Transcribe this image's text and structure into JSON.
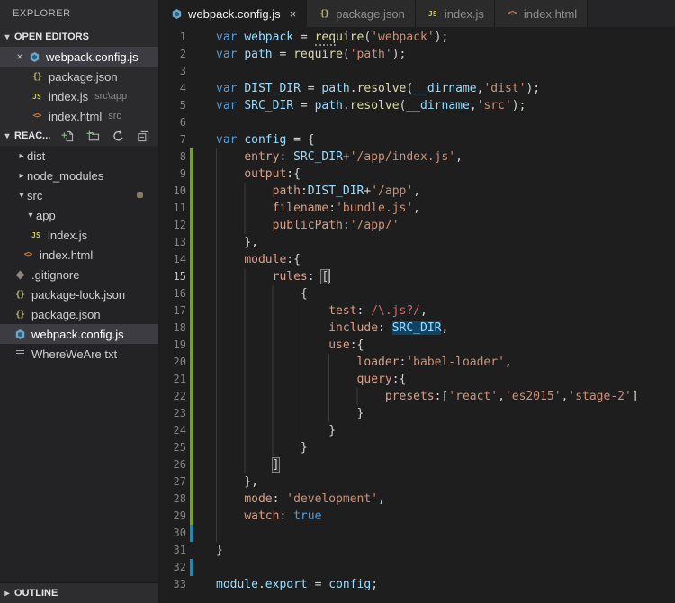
{
  "sidebar": {
    "title": "EXPLORER",
    "open_editors": {
      "header": "OPEN EDITORS",
      "items": [
        {
          "name": "webpack.config.js",
          "icon": "webpack",
          "active": true
        },
        {
          "name": "package.json",
          "icon": "json"
        },
        {
          "name": "index.js",
          "icon": "js",
          "path": "src\\app"
        },
        {
          "name": "index.html",
          "icon": "html",
          "path": "src"
        }
      ]
    },
    "project": {
      "header": "REAC...",
      "actions": [
        "new-file",
        "new-folder",
        "refresh",
        "collapse-all"
      ]
    },
    "tree": [
      {
        "name": "dist",
        "type": "folder",
        "collapsed": true,
        "level": 0
      },
      {
        "name": "node_modules",
        "type": "folder",
        "collapsed": true,
        "level": 0
      },
      {
        "name": "src",
        "type": "folder",
        "collapsed": false,
        "level": 0,
        "badge": true
      },
      {
        "name": "app",
        "type": "folder",
        "collapsed": false,
        "level": 1
      },
      {
        "name": "index.js",
        "icon": "js",
        "level": 2
      },
      {
        "name": "index.html",
        "icon": "html",
        "level": 1
      },
      {
        "name": ".gitignore",
        "icon": "git",
        "level": 0
      },
      {
        "name": "package-lock.json",
        "icon": "json",
        "level": 0
      },
      {
        "name": "package.json",
        "icon": "json",
        "level": 0
      },
      {
        "name": "webpack.config.js",
        "icon": "webpack",
        "level": 0,
        "selected": true
      },
      {
        "name": "WhereWeAre.txt",
        "icon": "txt",
        "level": 0
      }
    ],
    "outline": {
      "header": "OUTLINE"
    }
  },
  "tabs": [
    {
      "label": "webpack.config.js",
      "icon": "webpack",
      "active": true,
      "close_label": "×"
    },
    {
      "label": "package.json",
      "icon": "json"
    },
    {
      "label": "index.js",
      "icon": "js"
    },
    {
      "label": "index.html",
      "icon": "html"
    }
  ],
  "colors": {
    "added_gutter": "#7aa026",
    "modified_gutter": "#208bb2",
    "keyword": "#569cd6",
    "variable": "#9cdcfe",
    "function": "#dcdcaa",
    "string": "#ce9178",
    "object_key": "#d7a08a",
    "regex": "#d16969",
    "webpack_icon_blue": "#6ba7c9",
    "js_icon_yellow": "#cbcb41",
    "html_icon_orange": "#e37933"
  },
  "editor": {
    "lines": [
      {
        "n": 1,
        "i": 0,
        "t": [
          [
            "kw",
            "var"
          ],
          [
            "pn",
            " "
          ],
          [
            "vr",
            "webpack"
          ],
          [
            "pn",
            " = "
          ],
          [
            "fn sq",
            "req"
          ],
          [
            "fn",
            "uire"
          ],
          [
            "pn",
            "("
          ],
          [
            "st",
            "'webpack'"
          ],
          [
            "pn",
            ");"
          ]
        ]
      },
      {
        "n": 2,
        "i": 0,
        "t": [
          [
            "kw",
            "var"
          ],
          [
            "pn",
            " "
          ],
          [
            "vr",
            "path"
          ],
          [
            "pn",
            " = "
          ],
          [
            "fn",
            "require"
          ],
          [
            "pn",
            "("
          ],
          [
            "st",
            "'path'"
          ],
          [
            "pn",
            ");"
          ]
        ]
      },
      {
        "n": 3,
        "i": 0,
        "t": []
      },
      {
        "n": 4,
        "i": 0,
        "t": [
          [
            "kw",
            "var"
          ],
          [
            "pn",
            " "
          ],
          [
            "vr",
            "DIST_DIR"
          ],
          [
            "pn",
            " = "
          ],
          [
            "vr",
            "path"
          ],
          [
            "pn",
            "."
          ],
          [
            "fn",
            "resolve"
          ],
          [
            "pn",
            "("
          ],
          [
            "vr",
            "__dirname"
          ],
          [
            "pn",
            ","
          ],
          [
            "st",
            "'dist'"
          ],
          [
            "pn",
            ");"
          ]
        ]
      },
      {
        "n": 5,
        "i": 0,
        "t": [
          [
            "kw",
            "var"
          ],
          [
            "pn",
            " "
          ],
          [
            "vr",
            "SRC_DIR"
          ],
          [
            "pn",
            " = "
          ],
          [
            "vr",
            "path"
          ],
          [
            "pn",
            "."
          ],
          [
            "fn",
            "resolve"
          ],
          [
            "pn",
            "("
          ],
          [
            "vr",
            "__dirname"
          ],
          [
            "pn",
            ","
          ],
          [
            "st",
            "'src'"
          ],
          [
            "pn",
            ");"
          ]
        ]
      },
      {
        "n": 6,
        "i": 0,
        "t": []
      },
      {
        "n": 7,
        "i": 0,
        "t": [
          [
            "kw",
            "var"
          ],
          [
            "pn",
            " "
          ],
          [
            "vr",
            "config"
          ],
          [
            "pn",
            " = {"
          ]
        ]
      },
      {
        "n": 8,
        "i": 4,
        "d": "a",
        "t": [
          [
            "ky",
            "entry"
          ],
          [
            "pn",
            ": "
          ],
          [
            "vr",
            "SRC_DIR"
          ],
          [
            "pn",
            "+"
          ],
          [
            "st",
            "'/app/index.js'"
          ],
          [
            "pn",
            ","
          ]
        ]
      },
      {
        "n": 9,
        "i": 4,
        "d": "a",
        "t": [
          [
            "ky",
            "output"
          ],
          [
            "pn",
            ":{"
          ]
        ]
      },
      {
        "n": 10,
        "i": 8,
        "d": "a",
        "t": [
          [
            "ky",
            "path"
          ],
          [
            "pn",
            ":"
          ],
          [
            "vr",
            "DIST_DIR"
          ],
          [
            "pn",
            "+"
          ],
          [
            "st",
            "'/app'"
          ],
          [
            "pn",
            ","
          ]
        ]
      },
      {
        "n": 11,
        "i": 8,
        "d": "a",
        "t": [
          [
            "ky",
            "filename"
          ],
          [
            "pn",
            ":"
          ],
          [
            "st",
            "'bundle.js'"
          ],
          [
            "pn",
            ","
          ]
        ]
      },
      {
        "n": 12,
        "i": 8,
        "d": "a",
        "t": [
          [
            "ky",
            "publicPath"
          ],
          [
            "pn",
            ":"
          ],
          [
            "st",
            "'/app/'"
          ]
        ]
      },
      {
        "n": 13,
        "i": 4,
        "d": "a",
        "t": [
          [
            "pn",
            "},"
          ]
        ]
      },
      {
        "n": 14,
        "i": 4,
        "d": "a",
        "t": [
          [
            "ky",
            "module"
          ],
          [
            "pn",
            ":{"
          ]
        ]
      },
      {
        "n": 15,
        "i": 8,
        "d": "a",
        "active": true,
        "t": [
          [
            "ky",
            "rules"
          ],
          [
            "pn",
            ": "
          ],
          [
            "pn bm",
            "["
          ],
          [
            "cur",
            ""
          ]
        ]
      },
      {
        "n": 16,
        "i": 12,
        "d": "a",
        "t": [
          [
            "pn",
            "{"
          ]
        ]
      },
      {
        "n": 17,
        "i": 16,
        "d": "a",
        "t": [
          [
            "ky",
            "test"
          ],
          [
            "pn",
            ": "
          ],
          [
            "rx",
            "/\\.js?/"
          ],
          [
            "pn",
            ","
          ]
        ]
      },
      {
        "n": 18,
        "i": 16,
        "d": "a",
        "t": [
          [
            "ky",
            "include"
          ],
          [
            "pn",
            ": "
          ],
          [
            "vr hl",
            "SRC_DIR"
          ],
          [
            "pn",
            ","
          ]
        ]
      },
      {
        "n": 19,
        "i": 16,
        "d": "a",
        "t": [
          [
            "ky",
            "use"
          ],
          [
            "pn",
            ":{"
          ]
        ]
      },
      {
        "n": 20,
        "i": 20,
        "d": "a",
        "t": [
          [
            "ky",
            "loader"
          ],
          [
            "pn",
            ":"
          ],
          [
            "st",
            "'babel-loader'"
          ],
          [
            "pn",
            ","
          ]
        ]
      },
      {
        "n": 21,
        "i": 20,
        "d": "a",
        "t": [
          [
            "ky",
            "query"
          ],
          [
            "pn",
            ":{"
          ]
        ]
      },
      {
        "n": 22,
        "i": 24,
        "d": "a",
        "t": [
          [
            "ky",
            "presets"
          ],
          [
            "pn",
            ":["
          ],
          [
            "st",
            "'react'"
          ],
          [
            "pn",
            ","
          ],
          [
            "st",
            "'es2015'"
          ],
          [
            "pn",
            ","
          ],
          [
            "st",
            "'stage-2'"
          ],
          [
            "pn",
            "]"
          ]
        ]
      },
      {
        "n": 23,
        "i": 20,
        "d": "a",
        "t": [
          [
            "pn",
            "}"
          ]
        ]
      },
      {
        "n": 24,
        "i": 16,
        "d": "a",
        "t": [
          [
            "pn",
            "}"
          ]
        ]
      },
      {
        "n": 25,
        "i": 12,
        "d": "a",
        "t": [
          [
            "pn",
            "}"
          ]
        ]
      },
      {
        "n": 26,
        "i": 8,
        "d": "a",
        "t": [
          [
            "pn bm",
            "]"
          ]
        ]
      },
      {
        "n": 27,
        "i": 4,
        "d": "a",
        "t": [
          [
            "pn",
            "},"
          ]
        ]
      },
      {
        "n": 28,
        "i": 4,
        "d": "a",
        "t": [
          [
            "ky",
            "mode"
          ],
          [
            "pn",
            ": "
          ],
          [
            "st",
            "'development'"
          ],
          [
            "pn",
            ","
          ]
        ]
      },
      {
        "n": 29,
        "i": 4,
        "d": "a",
        "t": [
          [
            "ky",
            "watch"
          ],
          [
            "pn",
            ": "
          ],
          [
            "kw",
            "true"
          ]
        ]
      },
      {
        "n": 30,
        "i": 4,
        "d": "m",
        "t": []
      },
      {
        "n": 31,
        "i": 0,
        "t": [
          [
            "pn",
            "}"
          ]
        ]
      },
      {
        "n": 32,
        "i": 0,
        "d": "m",
        "t": []
      },
      {
        "n": 33,
        "i": 0,
        "t": [
          [
            "vr",
            "module"
          ],
          [
            "pn",
            "."
          ],
          [
            "vr",
            "export"
          ],
          [
            "pn",
            " = "
          ],
          [
            "vr",
            "config"
          ],
          [
            "pn",
            ";"
          ]
        ]
      }
    ]
  }
}
